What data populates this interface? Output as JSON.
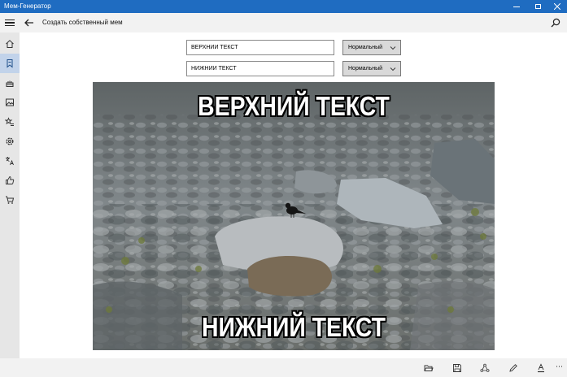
{
  "window": {
    "title": "Мем-Генератор",
    "controls": [
      "minimize",
      "maximize",
      "close"
    ]
  },
  "header": {
    "page_title": "Создать собственный мем",
    "back_icon": "back-arrow-icon",
    "search_icon": "search-icon"
  },
  "sidebar": {
    "items": [
      {
        "icon": "home-icon",
        "active": false
      },
      {
        "icon": "bookmark-icon",
        "active": true
      },
      {
        "icon": "cake-icon",
        "active": false
      },
      {
        "icon": "image-icon",
        "active": false
      },
      {
        "icon": "star-list-icon",
        "active": false
      },
      {
        "icon": "settings-icon",
        "active": false
      },
      {
        "icon": "translate-icon",
        "active": false
      },
      {
        "icon": "thumbs-up-icon",
        "active": false
      },
      {
        "icon": "cart-icon",
        "active": false
      }
    ]
  },
  "editor": {
    "top_text_value": "ВЕРХНИЙ ТЕКСТ",
    "top_size_value": "Нормальный",
    "bottom_text_value": "НИЖНИЙ ТЕКСТ",
    "bottom_size_value": "Нормальный"
  },
  "meme": {
    "top_caption": "ВЕРХНИЙ ТЕКСТ",
    "bottom_caption": "НИЖНИЙ ТЕКСТ",
    "image": "bird-on-rocks"
  },
  "appbar": {
    "buttons": [
      "folder-open-icon",
      "save-icon",
      "share-icon",
      "edit-icon",
      "font-color-icon",
      "more-icon"
    ]
  },
  "colors": {
    "titlebar": "#1f6cc1",
    "active_nav": "#c2d3ea",
    "sidebar": "#e6e6e6",
    "chrome": "#f2f2f2"
  }
}
